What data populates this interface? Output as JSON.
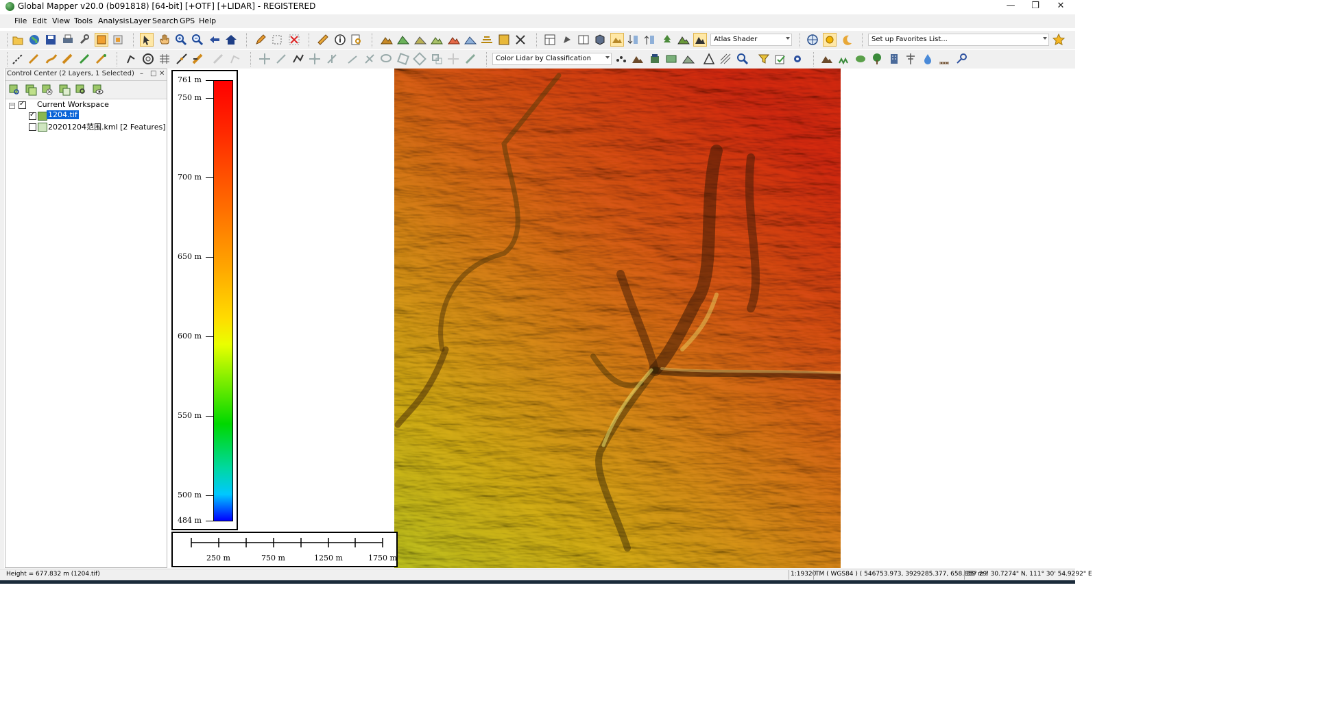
{
  "window": {
    "title": "Global Mapper v20.0 (b091818) [64-bit] [+OTF] [+LIDAR] - REGISTERED",
    "minimize": "—",
    "restore": "❐",
    "close": "✕"
  },
  "menu": [
    "File",
    "Edit",
    "View",
    "Tools",
    "Analysis",
    "Layer",
    "Search",
    "GPS",
    "Help"
  ],
  "toolbar": {
    "shader_select": "Atlas Shader",
    "favorites_select": "Set up Favorites List...",
    "lidar_color_select": "Color Lidar by Classification"
  },
  "control_center": {
    "title": "Control Center (2 Layers, 1 Selected)",
    "workspace": "Current Workspace",
    "layers": [
      {
        "name": "1204.tif",
        "checked": true,
        "selected": true
      },
      {
        "name": "20201204范围.kml [2 Features]",
        "checked": false,
        "selected": false
      }
    ]
  },
  "legend": {
    "labels": [
      "761 m",
      "750 m",
      "700 m",
      "650 m",
      "600 m",
      "550 m",
      "500 m",
      "484 m"
    ],
    "max_value": 761,
    "min_value": 484,
    "colors": [
      "#ff0000",
      "#ff6a00",
      "#ffa400",
      "#ffdc00",
      "#8cf000",
      "#00d800",
      "#00c8ff",
      "#0000ff"
    ]
  },
  "scale_bar": {
    "labels": [
      "250 m",
      "750 m",
      "1250 m",
      "1750 m"
    ]
  },
  "status": {
    "height": "Height = 677.832 m (1204.tif)",
    "scale": "1:19320",
    "projection": "TM ( WGS84 ) ( 546753.973, 3929285.377, 658.859 m )",
    "latlon": "35° 29' 30.7274\" N, 111° 30' 54.9292\" E"
  }
}
